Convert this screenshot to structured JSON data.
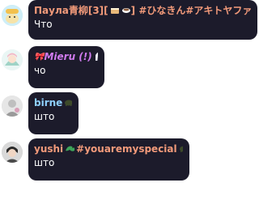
{
  "messages": [
    {
      "author": "Паула青柳[3][",
      "author_tail": "] #ひなきん#アキトヤファ...",
      "author_color": "#f29a7a",
      "badge_icons": [
        "cake-icon",
        "coffee-icon"
      ],
      "text": "Что"
    },
    {
      "author_prefix": "🎀",
      "author": "Mieru (!)",
      "author_color": "#d07af0",
      "badge_icons": [
        "hooded-figure-icon"
      ],
      "text": "чо"
    },
    {
      "author": "birne",
      "author_color": "#8fd0ff",
      "badge_icons": [
        "turtle-icon"
      ],
      "text": "што"
    },
    {
      "author": "yushi",
      "author_tail": " #youaremyspecial",
      "author_color": "#f29a7a",
      "badge_icons": [
        "lizard-icon",
        "turtle-icon"
      ],
      "text": "што"
    }
  ]
}
